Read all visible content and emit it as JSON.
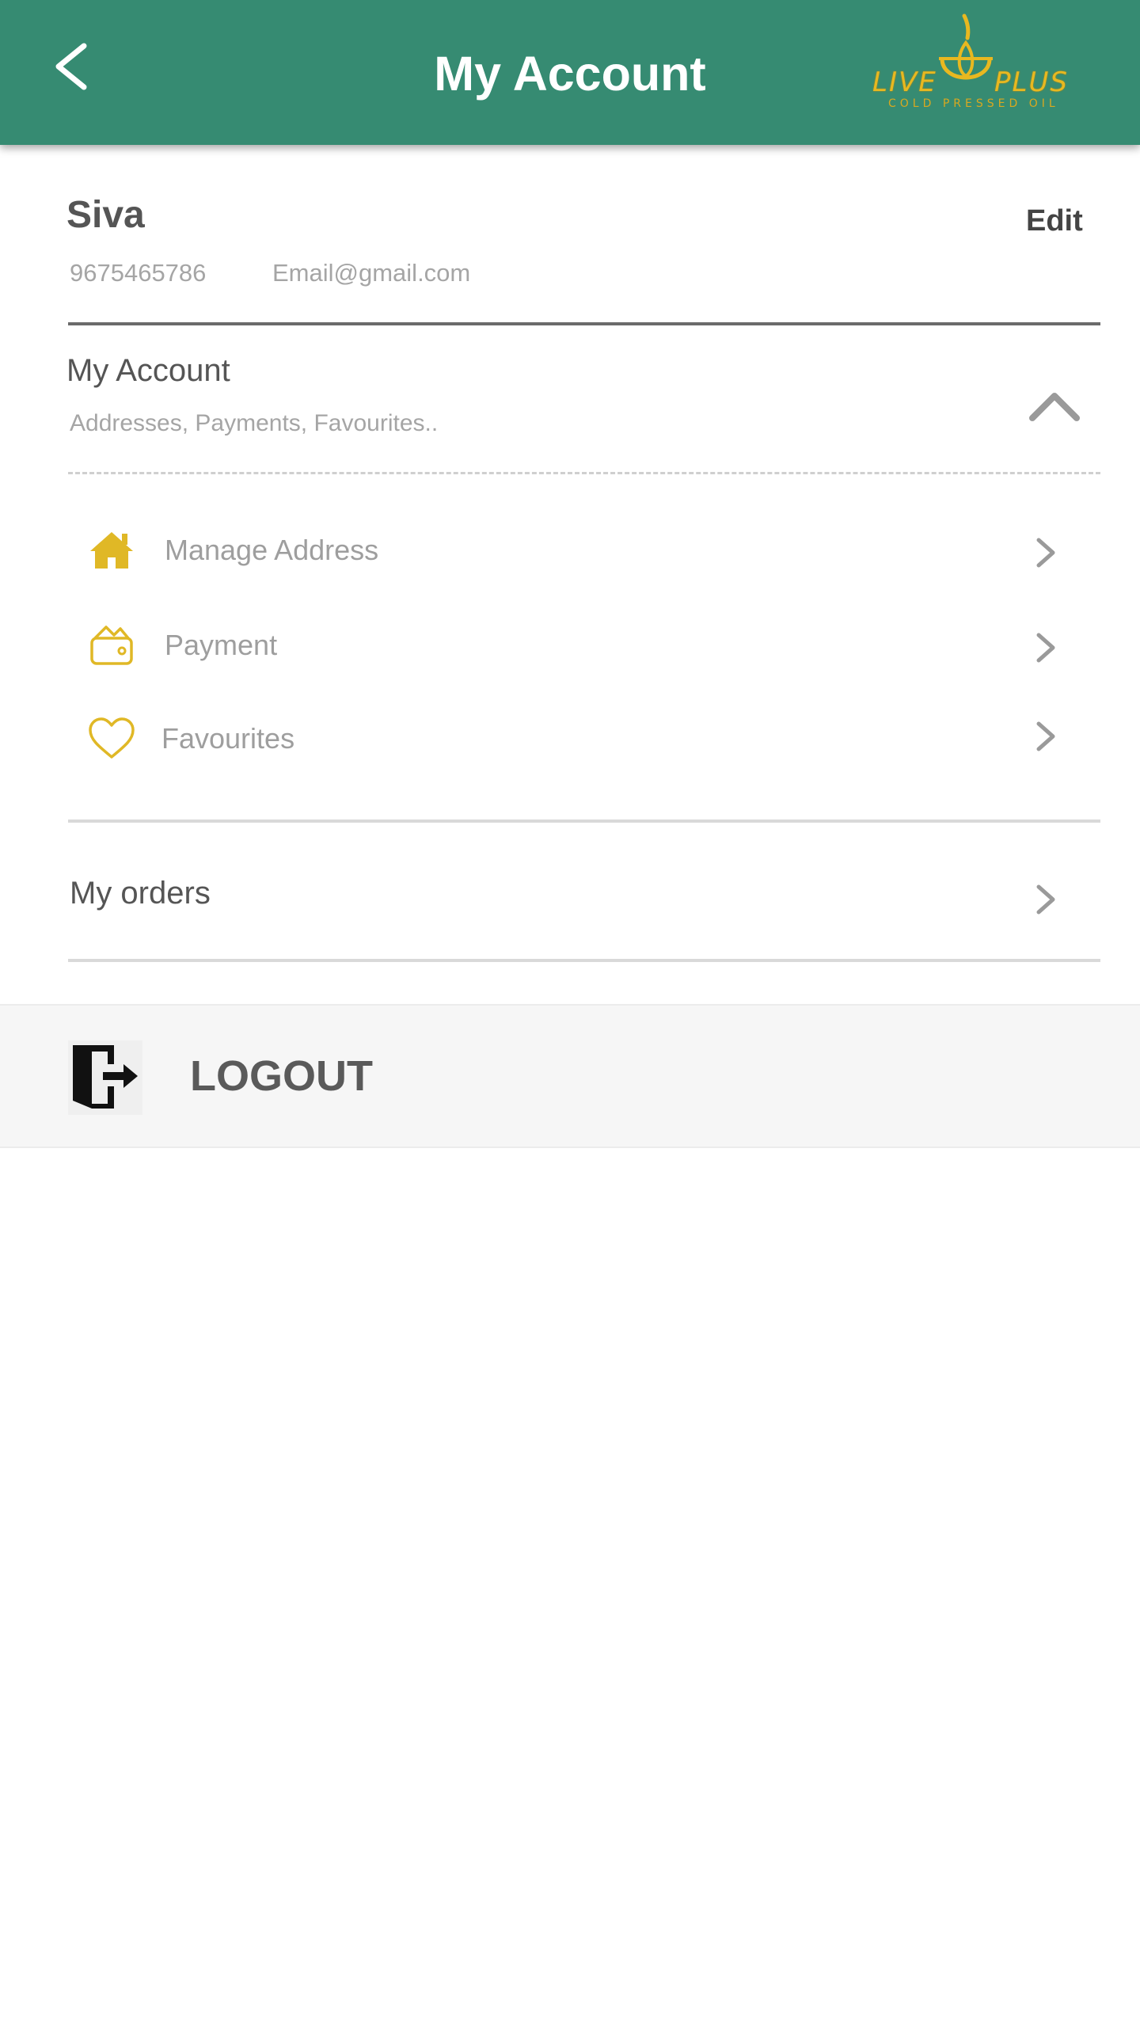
{
  "header": {
    "title": "My Account",
    "logo": {
      "word_left": "LIVE",
      "word_right": "PLUS",
      "tagline": "COLD PRESSED OIL"
    }
  },
  "profile": {
    "name": "Siva",
    "edit_label": "Edit",
    "phone": "9675465786",
    "email": "Email@gmail.com"
  },
  "account_section": {
    "title": "My Account",
    "subtitle": "Addresses, Payments, Favourites..",
    "items": [
      {
        "label": "Manage Address",
        "icon": "home-icon"
      },
      {
        "label": "Payment",
        "icon": "wallet-icon"
      },
      {
        "label": "Favourites",
        "icon": "heart-icon"
      }
    ]
  },
  "orders": {
    "label": "My orders"
  },
  "logout": {
    "label": "LOGOUT",
    "icon": "logout-door-icon"
  },
  "colors": {
    "header_bg": "#368b72",
    "accent_gold": "#e0b826",
    "text_dark": "#555555",
    "text_muted": "#a5a5a5"
  }
}
